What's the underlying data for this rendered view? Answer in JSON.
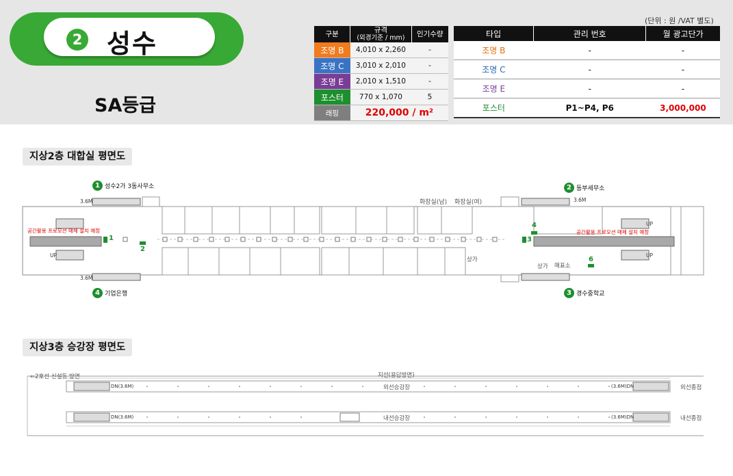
{
  "station": {
    "number": "2",
    "name": "성수",
    "grade": "SA등급"
  },
  "unit_note": "(단위 : 원 /VAT 별도)",
  "spec_table": {
    "headers": [
      "구분",
      "규격",
      "(외경기준 / mm)",
      "인기수량"
    ],
    "rows": [
      {
        "type": "조명 B",
        "size": "4,010 x 2,260",
        "qty": "-",
        "color": "#f07c1e"
      },
      {
        "type": "조명 C",
        "size": "3,010 x 2,010",
        "qty": "-",
        "color": "#3b73c4"
      },
      {
        "type": "조명 E",
        "size": "2,010 x 1,510",
        "qty": "-",
        "color": "#7a3d97"
      },
      {
        "type": "포스터",
        "size": "770 x 1,070",
        "qty": "5",
        "color": "#1e8f2e"
      }
    ],
    "price_label": "래핑",
    "price_value": "220,000 / m²"
  },
  "ad_table": {
    "headers": [
      "타입",
      "관리 번호",
      "월 광고단가"
    ],
    "rows": [
      {
        "type": "조명 B",
        "id": "-",
        "price": "-",
        "color": "#e46c0a"
      },
      {
        "type": "조명 C",
        "id": "-",
        "price": "-",
        "color": "#2e63b0"
      },
      {
        "type": "조명 E",
        "id": "-",
        "price": "-",
        "color": "#7a3d97"
      },
      {
        "type": "포스터",
        "id": "P1~P4, P6",
        "price": "3,000,000",
        "color": "#1e8f2e"
      }
    ]
  },
  "floor2": {
    "title": "지상2층 대합실 평면도",
    "exits": [
      {
        "num": "1",
        "label": "성수2가 3동사무소"
      },
      {
        "num": "2",
        "label": "동부세무소"
      },
      {
        "num": "3",
        "label": "경수중학교"
      },
      {
        "num": "4",
        "label": "기업은행"
      }
    ],
    "toilet_m": "화장실(남)",
    "toilet_f": "화장실(여)",
    "escalator": "3.6M",
    "up": "UP",
    "note": "공간활용 프로모션 매체 설치 예정",
    "posters": [
      "1",
      "2",
      "3",
      "4",
      "6"
    ],
    "shop": "상가",
    "ticket": "매표소"
  },
  "floor3": {
    "title": "지상3층 승강장 평면도",
    "left_dir": "2호선 신설동 방면",
    "top_dir": "지선(용답방면)",
    "outer_platform": "외선승강장",
    "inner_platform": "내선승강장",
    "outer_end": "외선종점",
    "inner_end": "내선종점",
    "dn_left": "DN(3.6M)",
    "dn_right": "(3.6M)DN"
  }
}
